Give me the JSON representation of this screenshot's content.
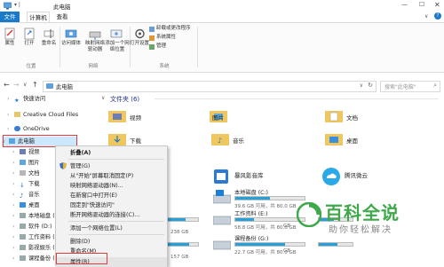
{
  "window": {
    "title": "此电脑"
  },
  "tabs": [
    "文件",
    "计算机",
    "查看"
  ],
  "ribbon": {
    "buttons": [
      "属性",
      "打开",
      "重命名",
      "访问媒体",
      "映射网络驱动器",
      "添加一个网络位置",
      "打开设置"
    ],
    "system_items": [
      "卸载或更改程序",
      "系统属性",
      "管理"
    ],
    "groups": [
      "位置",
      "网络",
      "系统"
    ]
  },
  "addressbar": {
    "path": "此电脑",
    "search_placeholder": "搜索\"此电脑\""
  },
  "nav": {
    "items": [
      "快速访问",
      "Creative Cloud Files",
      "OneDrive",
      "此电脑",
      "视频",
      "图片",
      "文档",
      "下载",
      "音乐",
      "桌面",
      "本地磁盘 (C",
      "软件 (D:)",
      "工作资料 (E",
      "影视娱乐 (F",
      "课程备份 (G"
    ]
  },
  "content": {
    "section_folders": "文件夹 (6)",
    "folders": [
      "视频",
      "图片",
      "文档",
      "下载",
      "音乐",
      "桌面"
    ],
    "apps": [
      "暴风影音库",
      "腾讯微云"
    ],
    "drives": [
      {
        "name": "本地磁盘 (C:)",
        "free": "39.6 GB 可用，共 80.0 GB",
        "fill": 0.5
      },
      {
        "name": "工作资料 (E:)",
        "free": "58.8 GB 可用，共 80.0 GB",
        "fill": 0.27
      },
      {
        "name": "课程备份 (G:)",
        "free": "22.7 GB 可用，共 80.0 GB",
        "fill": 0.72
      }
    ],
    "partial_drive_left": "238 GB",
    "partial_drive_left2": "157 GB",
    "partial_right_1": "GB",
    "partial_right_2": "GB"
  },
  "context_menu": {
    "items": [
      "折叠(A)",
      "管理(G)",
      "从\"开始\"屏幕取消固定(P)",
      "映射网络驱动器(N)...",
      "在新窗口中打开(E)",
      "固定到\"快速访问\"",
      "断开网络驱动器的连接(C)...",
      "添加一个网络位置(L)",
      "删除(D)",
      "重命名(M)",
      "属性(R)"
    ]
  },
  "watermark": {
    "title": "百科全说",
    "subtitle": "助你轻松解决"
  },
  "colors": {
    "accent": "#1979ca",
    "highlight": "#e23b3b",
    "watermark_green": "#3fa84a"
  }
}
